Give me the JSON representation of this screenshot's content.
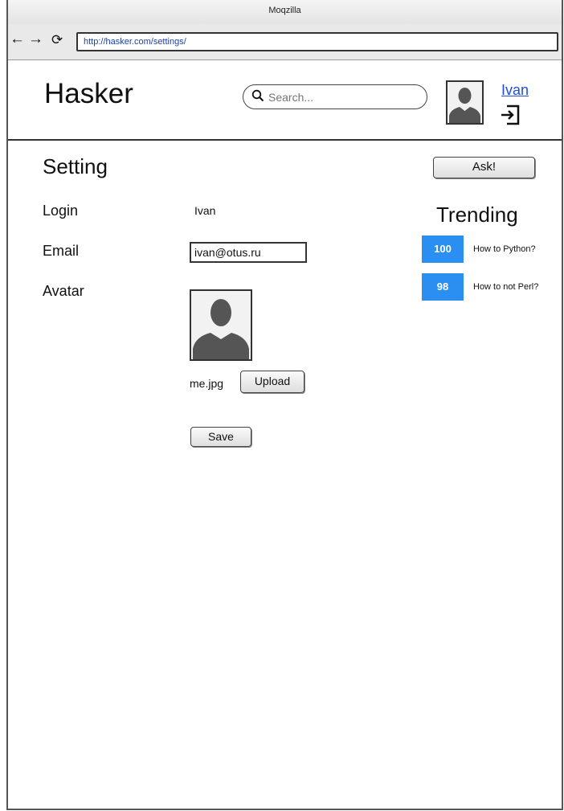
{
  "browser": {
    "title": "Moqzilla",
    "url": "http://hasker.com/settings/",
    "back_icon": "←",
    "forward_icon": "→",
    "reload_icon": "⟳"
  },
  "header": {
    "logo": "Hasker",
    "search_placeholder": "Search...",
    "user_name": "Ivan"
  },
  "settings": {
    "title": "Setting",
    "login_label": "Login",
    "login_value": "Ivan",
    "email_label": "Email",
    "email_value": "ivan@otus.ru",
    "avatar_label": "Avatar",
    "avatar_filename": "me.jpg",
    "upload_label": "Upload",
    "save_label": "Save"
  },
  "sidebar": {
    "ask_label": "Ask!",
    "trending_title": "Trending",
    "trending": [
      {
        "count": "100",
        "title": "How to Python?"
      },
      {
        "count": "98",
        "title": "How to not Perl?"
      }
    ]
  },
  "colors": {
    "accent": "#2a8ff0",
    "link": "#1f4ee0"
  }
}
